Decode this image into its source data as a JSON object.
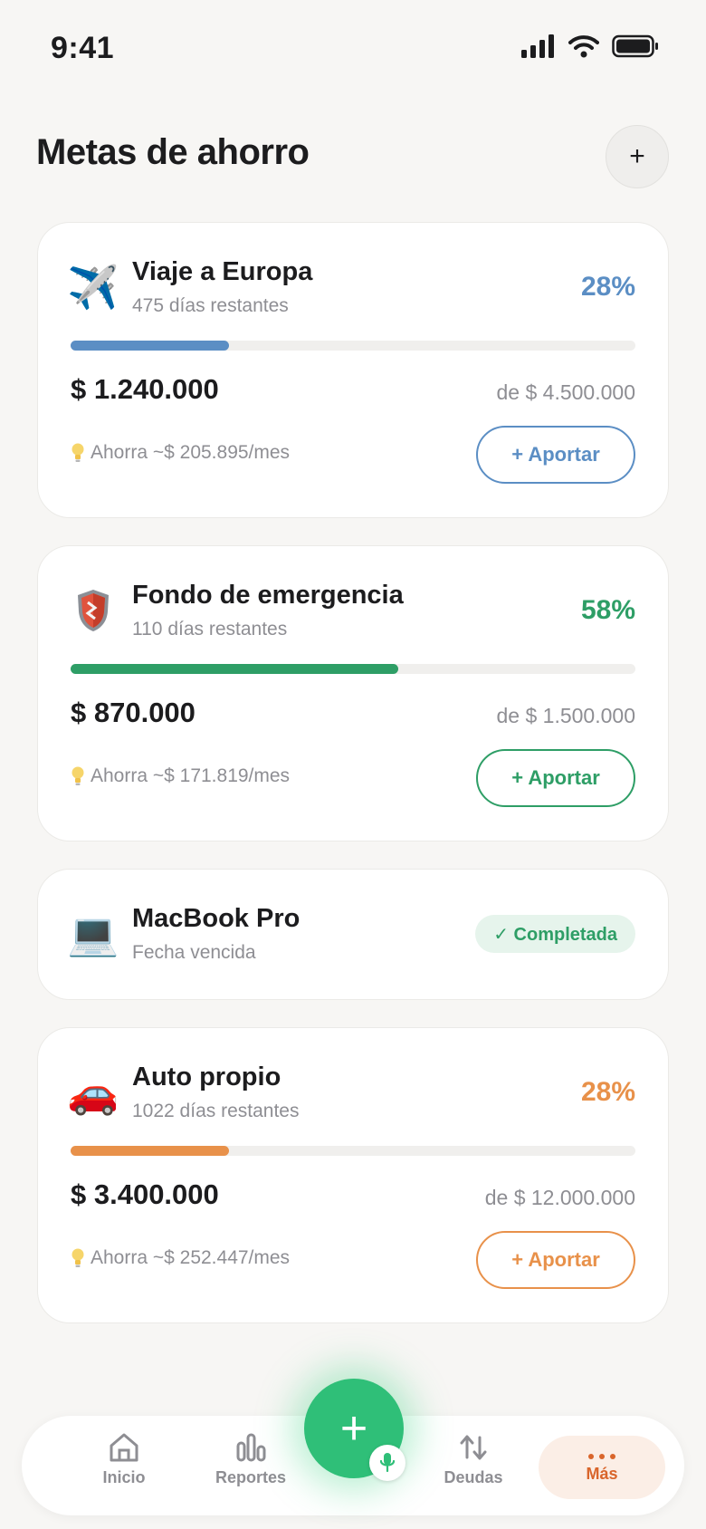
{
  "status_bar": {
    "time": "9:41"
  },
  "header": {
    "title": "Metas de ahorro",
    "add_label": "+"
  },
  "goals": [
    {
      "icon": "airplane-icon",
      "emoji": "✈️",
      "name": "Viaje a Europa",
      "subtitle": "475 días restantes",
      "percent_label": "28%",
      "progress": 0.28,
      "amount": "$ 1.240.000",
      "target": "de $ 4.500.000",
      "tip": "Ahorra ~$ 205.895/mes",
      "button": "+ Aportar",
      "accent": "#5b8ec4"
    },
    {
      "icon": "shield-icon",
      "emoji": "",
      "name": "Fondo de emergencia",
      "subtitle": "110 días restantes",
      "percent_label": "58%",
      "progress": 0.58,
      "amount": "$ 870.000",
      "target": "de $ 1.500.000",
      "tip": "Ahorra ~$ 171.819/mes",
      "button": "+ Aportar",
      "accent": "#2e9e66"
    },
    {
      "icon": "laptop-icon",
      "emoji": "💻",
      "name": "MacBook Pro",
      "subtitle": "Fecha vencida",
      "status": "✓ Completada",
      "accent": "#2e9e66"
    },
    {
      "icon": "car-icon",
      "emoji": "🚗",
      "name": "Auto propio",
      "subtitle": "1022 días restantes",
      "percent_label": "28%",
      "progress": 0.28,
      "amount": "$ 3.400.000",
      "target": "de $ 12.000.000",
      "tip": "Ahorra ~$ 252.447/mes",
      "button": "+ Aportar",
      "accent": "#e8914a"
    }
  ],
  "tip_icon": "lightbulb-icon",
  "nav": {
    "items": [
      {
        "label": "Inicio",
        "icon": "home-icon"
      },
      {
        "label": "Reportes",
        "icon": "chart-icon"
      },
      {
        "label": "Deudas",
        "icon": "transfer-icon"
      },
      {
        "label": "Más",
        "icon": "more-icon"
      }
    ],
    "fab_label": "+",
    "active": "Más",
    "active_color": "#d9652b"
  }
}
